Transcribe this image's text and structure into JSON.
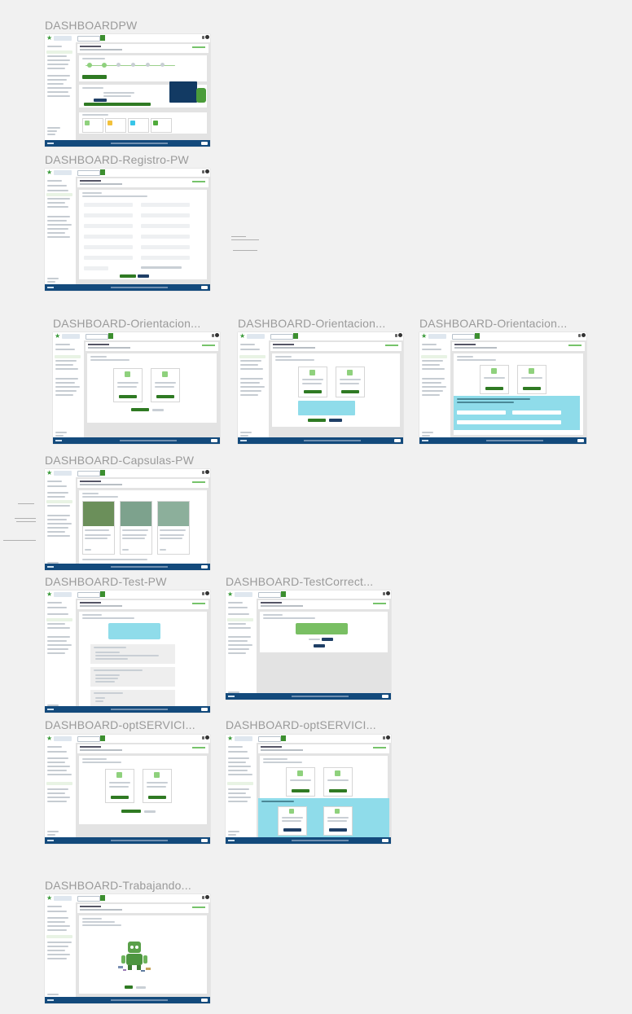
{
  "frames": [
    {
      "key": "dashboard_pw",
      "label": "DASHBOARDPW"
    },
    {
      "key": "registro",
      "label": "DASHBOARD-Registro-PW"
    },
    {
      "key": "orient1",
      "label": "DASHBOARD-Orientacion..."
    },
    {
      "key": "orient2",
      "label": "DASHBOARD-Orientacion..."
    },
    {
      "key": "orient3",
      "label": "DASHBOARD-Orientacion..."
    },
    {
      "key": "capsulas",
      "label": "DASHBOARD-Capsulas-PW"
    },
    {
      "key": "test",
      "label": "DASHBOARD-Test-PW"
    },
    {
      "key": "testcorrect",
      "label": "DASHBOARD-TestCorrect..."
    },
    {
      "key": "opt1",
      "label": "DASHBOARD-optSERVICI..."
    },
    {
      "key": "opt2",
      "label": "DASHBOARD-optSERVICI..."
    },
    {
      "key": "trabajando",
      "label": "DASHBOARD-Trabajando..."
    }
  ],
  "colors": {
    "canvas": "#f1f1f1",
    "brand_green": "#3c8f2f",
    "footer_blue": "#134a7c",
    "cyan_panel": "#8fdcea"
  }
}
